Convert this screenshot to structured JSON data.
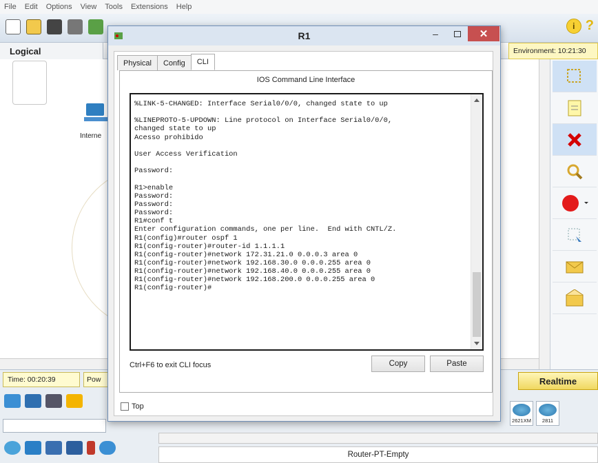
{
  "menu": [
    "File",
    "Edit",
    "Options",
    "View",
    "Tools",
    "Extensions",
    "Help"
  ],
  "workspace": {
    "tab_label": "Logical",
    "environment_label": "Environment: 10:21:30",
    "internet_label": "Interne"
  },
  "status": {
    "time": "Time: 00:20:39",
    "power_label": "Pow",
    "realtime_label": "Realtime"
  },
  "device_panel": {
    "router_models": [
      "2621XM",
      "2811"
    ],
    "selected_device_label": "Router-PT-Empty"
  },
  "dialog": {
    "title": "R1",
    "tabs": [
      {
        "label": "Physical",
        "active": false
      },
      {
        "label": "Config",
        "active": false
      },
      {
        "label": "CLI",
        "active": true
      }
    ],
    "cli_heading": "IOS Command Line Interface",
    "terminal_lines": [
      "%LINK-5-CHANGED: Interface Serial0/0/0, changed state to up",
      "",
      "%LINEPROTO-5-UPDOWN: Line protocol on Interface Serial0/0/0,",
      "changed state to up",
      "Acesso prohibido",
      "",
      "User Access Verification",
      "",
      "Password:",
      "",
      "R1>enable",
      "Password:",
      "Password:",
      "Password:",
      "R1#conf t",
      "Enter configuration commands, one per line.  End with CNTL/Z.",
      "R1(config)#router ospf 1",
      "R1(config-router)#router-id 1.1.1.1",
      "R1(config-router)#network 172.31.21.0 0.0.0.3 area 0",
      "R1(config-router)#network 192.168.30.0 0.0.0.255 area 0",
      "R1(config-router)#network 192.168.40.0 0.0.0.255 area 0",
      "R1(config-router)#network 192.168.200.0 0.0.0.255 area 0",
      "R1(config-router)#"
    ],
    "hint": "Ctrl+F6 to exit CLI focus",
    "copy_label": "Copy",
    "paste_label": "Paste",
    "top_label": "Top",
    "top_checked": false
  },
  "colors": {
    "close_button": "#c75050",
    "titlebar": "#dbe5f1",
    "realtime_bg": "#f0d860"
  }
}
